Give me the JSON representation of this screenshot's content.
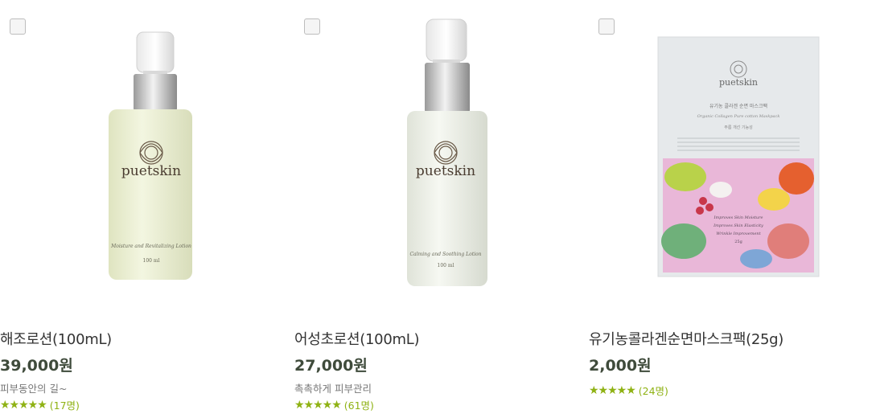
{
  "products": [
    {
      "name": "해조로션(100mL)",
      "price": "39,000원",
      "desc": "피부동안의 길~",
      "stars": "★★★★★",
      "reviews": "(17명)",
      "label": {
        "brand": "puetskin",
        "line": "Moisture and Revitalizing Lotion",
        "volume": "100 ml"
      },
      "bottle_color": "#edf0d3"
    },
    {
      "name": "어성초로션(100mL)",
      "price": "27,000원",
      "desc": "촉촉하게 피부관리",
      "stars": "★★★★★",
      "reviews": "(61명)",
      "label": {
        "brand": "puetskin",
        "line": "Calming and Soothing Lotion",
        "volume": "100 ml"
      },
      "bottle_color": "#eff2ea"
    },
    {
      "name": "유기농콜라겐순면마스크팩(25g)",
      "price": "2,000원",
      "desc": "",
      "stars": "★★★★★",
      "reviews": "(24명)",
      "label": {
        "brand": "puetskin",
        "title_ko": "유기농 콜라겐 순면 마스크팩",
        "title_en": "Organic Collagen Pure cotton Maskpack",
        "sub_ko": "주름 개선 기능성",
        "claims": [
          "Improves Skin Moisture",
          "Improves Skin Elasticity",
          "Wrinkle Improvement"
        ],
        "weight": "25g"
      }
    }
  ],
  "colors": {
    "accent": "#8fb214",
    "price": "#3f4b3b"
  }
}
